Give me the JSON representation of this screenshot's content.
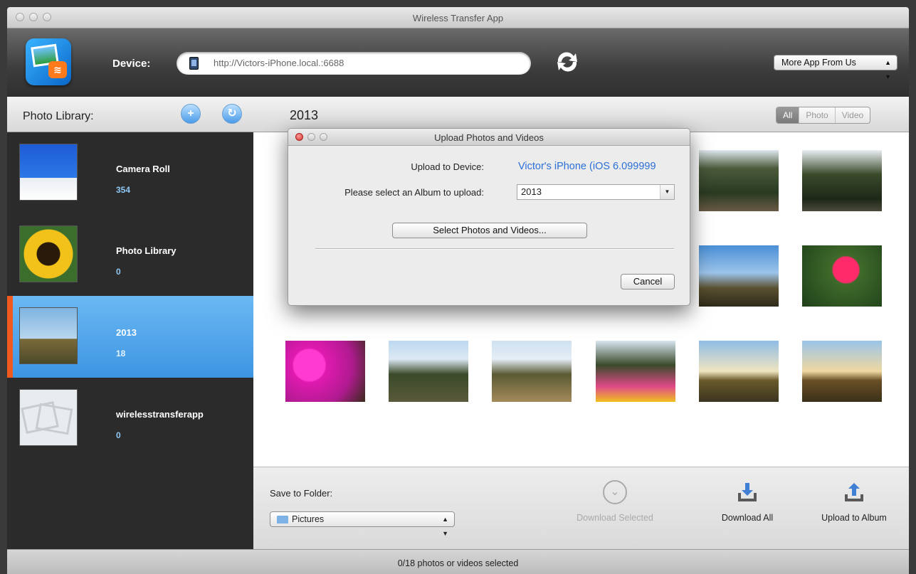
{
  "window": {
    "title": "Wireless Transfer App"
  },
  "toolbar": {
    "device_label": "Device:",
    "url": "http://Victors-iPhone.local.:6688",
    "more_app": "More App From Us"
  },
  "sidebar": {
    "title": "Photo Library:",
    "albums": [
      {
        "name": "Camera Roll",
        "count": "354"
      },
      {
        "name": "Photo Library",
        "count": "0"
      },
      {
        "name": "2013",
        "count": "18"
      },
      {
        "name": "wirelesstransferapp",
        "count": "0"
      }
    ]
  },
  "main": {
    "album_title": "2013",
    "filters": [
      "All",
      "Photo",
      "Video"
    ]
  },
  "bottom": {
    "save_to_folder_label": "Save to Folder:",
    "folder": "Pictures",
    "download_selected": "Download Selected",
    "download_all": "Download All",
    "upload_to_album": "Upload to Album"
  },
  "status": {
    "text": "0/18 photos or videos selected"
  },
  "dialog": {
    "title": "Upload Photos and Videos",
    "upload_to_device_label": "Upload to Device:",
    "device_name": "Victor's iPhone (iOS 6.099999",
    "select_album_label": "Please select an Album to upload:",
    "album": "2013",
    "select_button": "Select Photos and Videos...",
    "cancel_button": "Cancel"
  },
  "colors": {
    "selected_album": "#4a9fe6",
    "selected_marker": "#f05a1e",
    "device_name": "#2b6fd8"
  }
}
